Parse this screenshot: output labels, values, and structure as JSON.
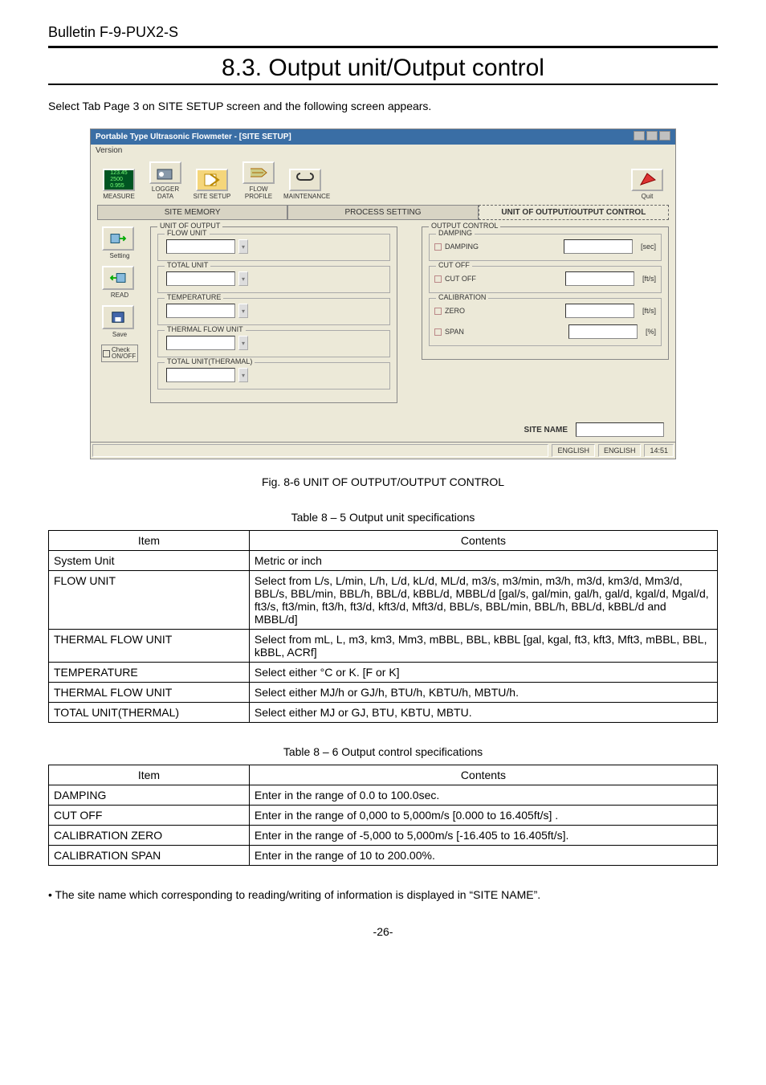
{
  "header": {
    "bulletin": "Bulletin F-9-PUX2-S",
    "section_title": "8.3. Output unit/Output control"
  },
  "intro": "Select Tab Page 3 on SITE SETUP screen and the following screen appears.",
  "screenshot": {
    "window_title": "Portable Type Ultrasonic Flowmeter - [SITE SETUP]",
    "menu_version": "Version",
    "toolbar": {
      "measure": "MEASURE",
      "logger": "LOGGER DATA",
      "sitesetup": "SITE SETUP",
      "flowprofile": "FLOW PROFILE",
      "maintenance": "MAINTENANCE",
      "quit": "Quit"
    },
    "tabs": {
      "site_memory": "SITE MEMORY",
      "process": "PROCESS SETTING",
      "output": "UNIT OF OUTPUT/OUTPUT CONTROL"
    },
    "side": {
      "setting": "Setting",
      "read": "READ",
      "save": "Save",
      "check": "Check ON/OFF"
    },
    "left_panel": {
      "group": "UNIT OF OUTPUT",
      "flow_unit": "FLOW UNIT",
      "total_unit": "TOTAL UNIT",
      "temperature": "TEMPERATURE",
      "thermal_flow": "THERMAL FLOW UNIT",
      "total_thermal": "TOTAL UNIT(THERAMAL)"
    },
    "right_panel": {
      "group": "OUTPUT CONTROL",
      "damping_grp": "DAMPING",
      "damping": "DAMPING",
      "damping_u": "[sec]",
      "cutoff_grp": "CUT OFF",
      "cutoff": "CUT OFF",
      "cutoff_u": "[ft/s]",
      "cal_grp": "CALIBRATION",
      "zero": "ZERO",
      "zero_u": "[ft/s]",
      "span": "SPAN",
      "span_u": "[%]"
    },
    "site_name_label": "SITE NAME",
    "status": {
      "lang1": "ENGLISH",
      "lang2": "ENGLISH",
      "time": "14:51"
    }
  },
  "fig_caption": "Fig. 8-6 UNIT OF OUTPUT/OUTPUT CONTROL",
  "table1": {
    "caption": "Table 8 – 5 Output unit specifications",
    "headers": {
      "item": "Item",
      "contents": "Contents"
    },
    "rows": [
      {
        "item": "System Unit",
        "contents": "Metric or inch"
      },
      {
        "item": "FLOW UNIT",
        "contents": "Select from L/s, L/min, L/h, L/d, kL/d, ML/d, m3/s, m3/min, m3/h, m3/d, km3/d, Mm3/d, BBL/s, BBL/min, BBL/h, BBL/d, kBBL/d, MBBL/d [gal/s, gal/min, gal/h, gal/d, kgal/d, Mgal/d, ft3/s, ft3/min, ft3/h, ft3/d, kft3/d, Mft3/d, BBL/s, BBL/min, BBL/h, BBL/d, kBBL/d and MBBL/d]"
      },
      {
        "item": "THERMAL FLOW UNIT",
        "contents": "Select from mL, L, m3, km3, Mm3, mBBL, BBL, kBBL [gal, kgal, ft3, kft3, Mft3, mBBL, BBL, kBBL, ACRf]"
      },
      {
        "item": "TEMPERATURE",
        "contents": "Select either °C or K. [F or K]"
      },
      {
        "item": "THERMAL FLOW UNIT",
        "contents": "Select either MJ/h or GJ/h, BTU/h, KBTU/h, MBTU/h."
      },
      {
        "item": "TOTAL UNIT(THERMAL)",
        "contents": "Select either MJ or GJ, BTU, KBTU, MBTU."
      }
    ]
  },
  "table2": {
    "caption": "Table 8 – 6 Output control specifications",
    "headers": {
      "item": "Item",
      "contents": "Contents"
    },
    "rows": [
      {
        "item": "DAMPING",
        "contents": "Enter in the range of 0.0 to 100.0sec."
      },
      {
        "item": "CUT OFF",
        "contents": "Enter in the range of 0,000 to 5,000m/s [0.000 to 16.405ft/s] ."
      },
      {
        "item": "CALIBRATION ZERO",
        "contents": "Enter in the range of -5,000 to 5,000m/s [-16.405 to 16.405ft/s]."
      },
      {
        "item": "CALIBRATION SPAN",
        "contents": "Enter in the range of 10 to 200.00%."
      }
    ]
  },
  "footnote": "The site name which corresponding to reading/writing of information is displayed in “SITE NAME”.",
  "page_number": "-26-"
}
